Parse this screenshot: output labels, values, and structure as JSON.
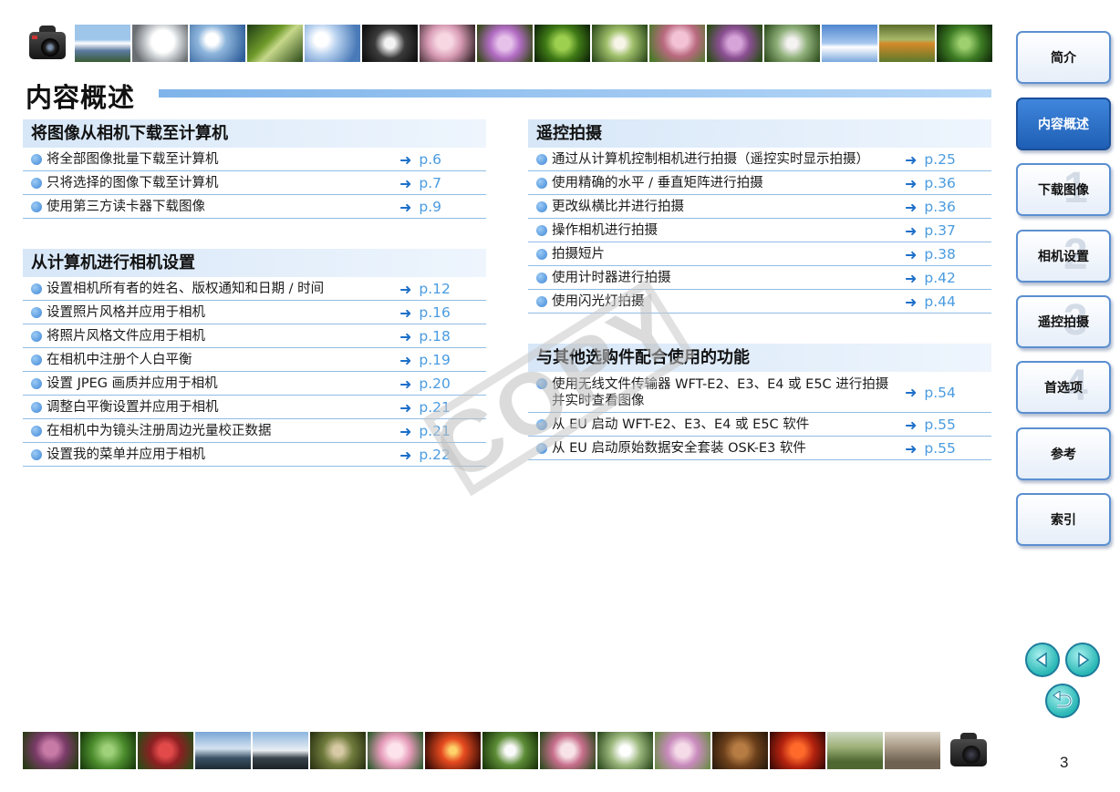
{
  "page": {
    "title": "内容概述",
    "number": "3"
  },
  "sections": [
    {
      "heading": "将图像从相机下载至计算机",
      "items": [
        {
          "text": "将全部图像批量下载至计算机",
          "ref": "p.6"
        },
        {
          "text": "只将选择的图像下载至计算机",
          "ref": "p.7"
        },
        {
          "text": "使用第三方读卡器下载图像",
          "ref": "p.9"
        }
      ]
    },
    {
      "heading": "从计算机进行相机设置",
      "items": [
        {
          "text": "设置相机所有者的姓名、版权通知和日期 / 时间",
          "ref": "p.12"
        },
        {
          "text": "设置照片风格并应用于相机",
          "ref": "p.16"
        },
        {
          "text": "将照片风格文件应用于相机",
          "ref": "p.18"
        },
        {
          "text": "在相机中注册个人白平衡",
          "ref": "p.19"
        },
        {
          "text": "设置 JPEG 画质并应用于相机",
          "ref": "p.20"
        },
        {
          "text": "调整白平衡设置并应用于相机",
          "ref": "p.21"
        },
        {
          "text": "在相机中为镜头注册周边光量校正数据",
          "ref": "p.21"
        },
        {
          "text": "设置我的菜单并应用于相机",
          "ref": "p.22"
        }
      ]
    },
    {
      "heading": "遥控拍摄",
      "items": [
        {
          "text": "通过从计算机控制相机进行拍摄（遥控实时显示拍摄）",
          "ref": "p.25"
        },
        {
          "text": "使用精确的水平 / 垂直矩阵进行拍摄",
          "ref": "p.36"
        },
        {
          "text": "更改纵横比并进行拍摄",
          "ref": "p.36"
        },
        {
          "text": "操作相机进行拍摄",
          "ref": "p.37"
        },
        {
          "text": "拍摄短片",
          "ref": "p.38"
        },
        {
          "text": "使用计时器进行拍摄",
          "ref": "p.42"
        },
        {
          "text": "使用闪光灯拍摄",
          "ref": "p.44"
        }
      ]
    },
    {
      "heading": "与其他选购件配合使用的功能",
      "items": [
        {
          "text": "使用无线文件传输器 WFT-E2、E3、E4 或 E5C 进行拍摄并实时查看图像",
          "ref": "p.54"
        },
        {
          "text": "从 EU 启动 WFT-E2、E3、E4 或 E5C 软件",
          "ref": "p.55"
        },
        {
          "text": "从 EU 启动原始数据安全套装 OSK-E3 软件",
          "ref": "p.55"
        }
      ]
    }
  ],
  "arrow_glyph": "➜",
  "sidebar": [
    {
      "label": "简介",
      "num": ""
    },
    {
      "label": "内容概述",
      "num": ""
    },
    {
      "label": "下载图像",
      "num": "1"
    },
    {
      "label": "相机设置",
      "num": "2"
    },
    {
      "label": "遥控拍摄",
      "num": "3"
    },
    {
      "label": "首选项",
      "num": "4"
    },
    {
      "label": "参考",
      "num": ""
    },
    {
      "label": "索引",
      "num": ""
    }
  ],
  "watermark": "COPY",
  "icons": {
    "camera": "camera-icon",
    "prev": "prev-page-icon",
    "next": "next-page-icon",
    "back": "return-icon"
  }
}
